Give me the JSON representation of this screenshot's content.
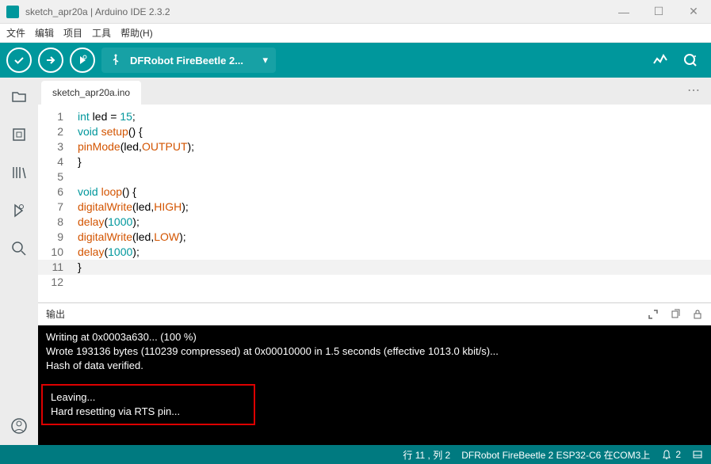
{
  "titlebar": {
    "text": "sketch_apr20a | Arduino IDE 2.3.2"
  },
  "menu": {
    "file": "文件",
    "edit": "编辑",
    "sketch": "项目",
    "tools": "工具",
    "help": "帮助(H)"
  },
  "board": {
    "label": "DFRobot FireBeetle 2..."
  },
  "tab": {
    "name": "sketch_apr20a.ino"
  },
  "code": {
    "lines": [
      {
        "n": "1",
        "html": "<span class='kw'>int</span> led = <span class='num'>15</span>;"
      },
      {
        "n": "2",
        "html": "<span class='kw'>void</span> <span class='fn'>setup</span>() {"
      },
      {
        "n": "3",
        "html": "<span class='fn'>pinMode</span>(led,<span class='fn'>OUTPUT</span>);"
      },
      {
        "n": "4",
        "html": "}"
      },
      {
        "n": "5",
        "html": ""
      },
      {
        "n": "6",
        "html": "<span class='kw'>void</span> <span class='fn'>loop</span>() {"
      },
      {
        "n": "7",
        "html": "<span class='fn'>digitalWrite</span>(led,<span class='fn'>HIGH</span>);"
      },
      {
        "n": "8",
        "html": "<span class='fn'>delay</span>(<span class='num'>1000</span>);"
      },
      {
        "n": "9",
        "html": "<span class='fn'>digitalWrite</span>(led,<span class='fn'>LOW</span>);"
      },
      {
        "n": "10",
        "html": "<span class='fn'>delay</span>(<span class='num'>1000</span>);"
      },
      {
        "n": "11",
        "html": "}",
        "active": true
      },
      {
        "n": "12",
        "html": ""
      }
    ]
  },
  "output": {
    "title": "输出",
    "lines": [
      "Writing at 0x0003a630... (100 %)",
      "Wrote 193136 bytes (110239 compressed) at 0x00010000 in 1.5 seconds (effective 1013.0 kbit/s)...",
      "Hash of data verified."
    ],
    "highlight": [
      "Leaving...",
      "Hard resetting via RTS pin..."
    ]
  },
  "status": {
    "cursor": "行 11 , 列 2",
    "board": "DFRobot FireBeetle 2 ESP32-C6 在COM3上",
    "notif": "2"
  }
}
